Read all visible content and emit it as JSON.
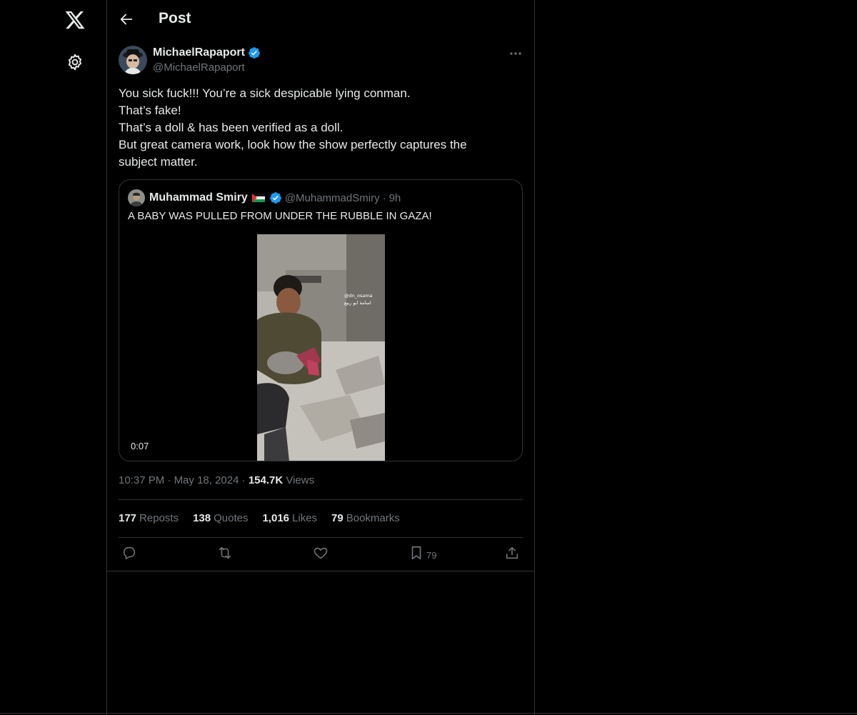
{
  "nav": {
    "logo_icon": "x-logo-icon",
    "settings_icon": "gear-icon"
  },
  "header": {
    "title": "Post",
    "back_icon": "arrow-left-icon"
  },
  "post": {
    "author_name": "MichaelRapaport",
    "author_handle": "@MichaelRapaport",
    "text_lines": [
      "You sick fuck!!! You’re a sick despicable lying conman.",
      "That’s fake!",
      "That’s a doll & has been verified as a doll.",
      "But great camera work, look how the show perfectly captures the",
      "subject matter."
    ],
    "time": "10:37 PM",
    "date": "May 18, 2024",
    "views_count": "154.7K",
    "views_label": "Views",
    "separator": "·"
  },
  "quote": {
    "author_name": "Muhammad Smiry",
    "author_handle": "@MuhammadSmiry",
    "separator": "·",
    "time": "9h",
    "text": "A BABY WAS PULLED FROM UNDER THE RUBBLE IN GAZA!",
    "video_duration": "0:07",
    "video_watermark": [
      "@dn_osama",
      "اسامة ابو ربيع"
    ]
  },
  "stats": {
    "reposts_count": "177",
    "reposts_label": "Reposts",
    "quotes_count": "138",
    "quotes_label": "Quotes",
    "likes_count": "1,016",
    "likes_label": "Likes",
    "bookmarks_count": "79",
    "bookmarks_label": "Bookmarks"
  },
  "actions": {
    "reply_icon": "reply-icon",
    "repost_icon": "repost-icon",
    "like_icon": "heart-icon",
    "bookmark_icon": "bookmark-icon",
    "bookmark_count": "79",
    "share_icon": "share-icon"
  },
  "colors": {
    "background": "#000000",
    "text": "#e7e9ea",
    "muted": "#71767b",
    "border": "#2f3336",
    "verified": "#1d9bf0"
  }
}
